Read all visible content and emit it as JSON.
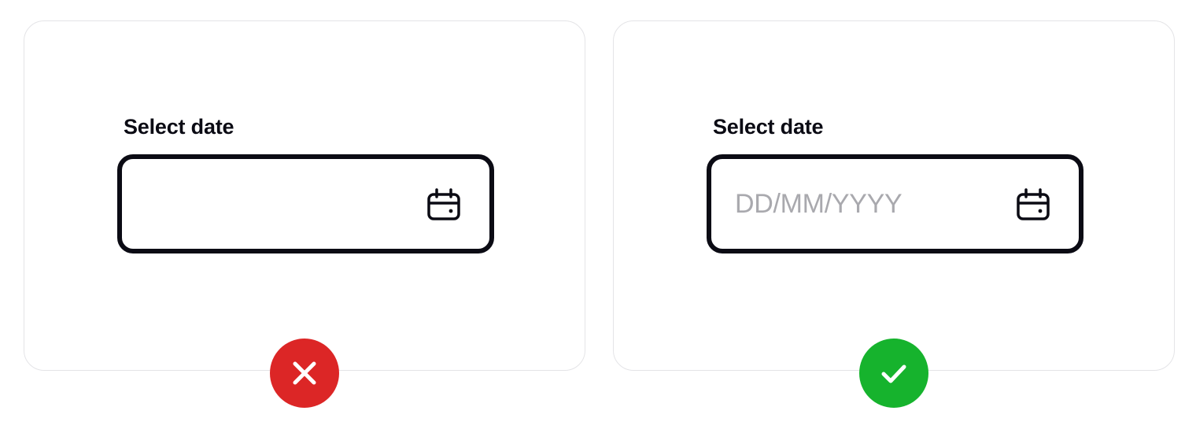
{
  "examples": [
    {
      "verdict": "incorrect",
      "label": "Select date",
      "placeholder": "",
      "field_icon": "calendar-icon",
      "badge_icon": "x-mark-icon",
      "badge_color": "#dc2626"
    },
    {
      "verdict": "correct",
      "label": "Select date",
      "placeholder": "DD/MM/YYYY",
      "field_icon": "calendar-icon",
      "badge_icon": "check-mark-icon",
      "badge_color": "#16b32d"
    }
  ],
  "colors": {
    "text": "#0b0b14",
    "border": "#0b0b14",
    "placeholder": "#a9a9ae",
    "card_border": "#e4e4e7"
  }
}
